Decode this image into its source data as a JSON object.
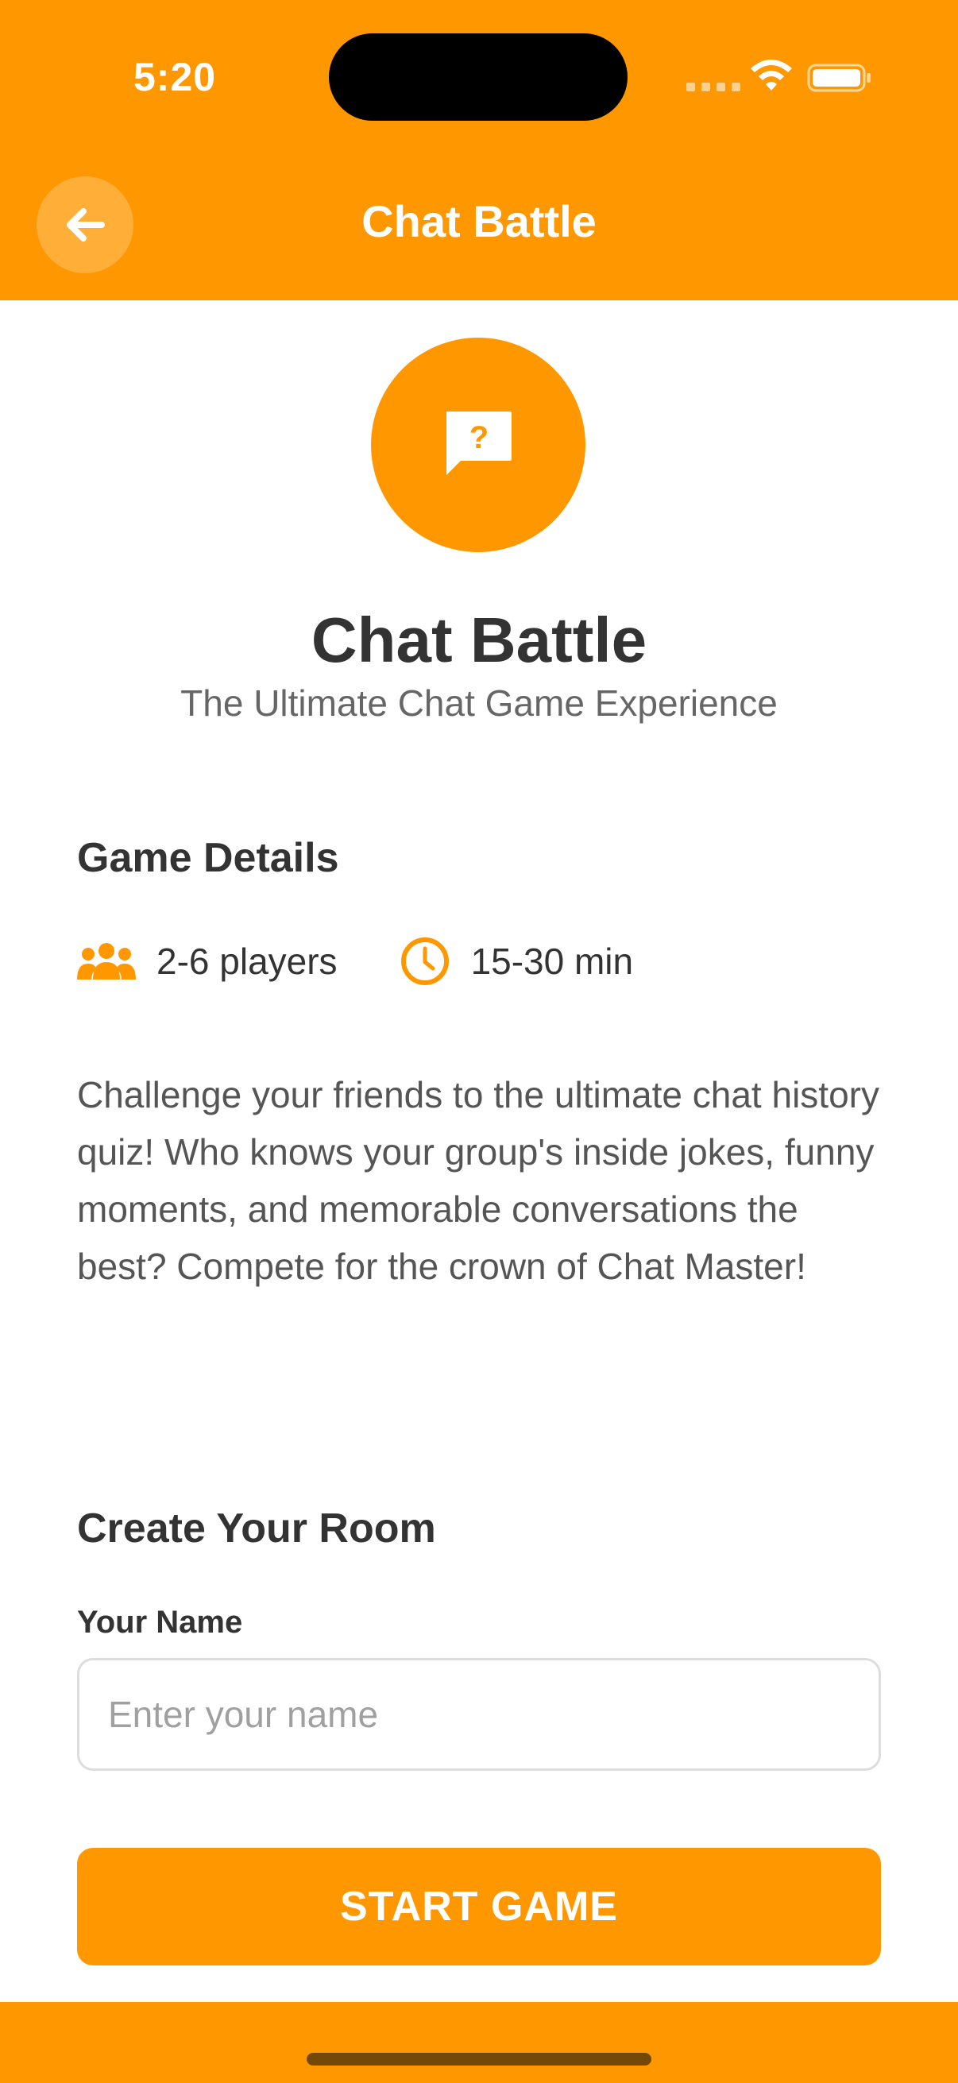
{
  "status_bar": {
    "time": "5:20"
  },
  "header": {
    "title": "Chat Battle",
    "back_icon": "arrow-left-icon",
    "background_color": "#FF9800"
  },
  "hero": {
    "icon": "chat-question-icon",
    "title": "Chat Battle",
    "subtitle": "The Ultimate Chat Game Experience"
  },
  "details": {
    "heading": "Game Details",
    "players": {
      "icon": "users-icon",
      "label": "2-6 players"
    },
    "duration": {
      "icon": "clock-icon",
      "label": "15-30 min"
    },
    "description": "Challenge your friends to the ultimate chat history quiz! Who knows your group's inside jokes, funny moments, and memorable conversations the best? Compete for the crown of Chat Master!"
  },
  "room": {
    "heading": "Create Your Room",
    "name_label": "Your Name",
    "name_placeholder": "Enter your name",
    "name_value": "",
    "start_button": "START GAME"
  },
  "colors": {
    "accent": "#FF9800",
    "text_primary": "#333333",
    "text_secondary": "#666666"
  }
}
